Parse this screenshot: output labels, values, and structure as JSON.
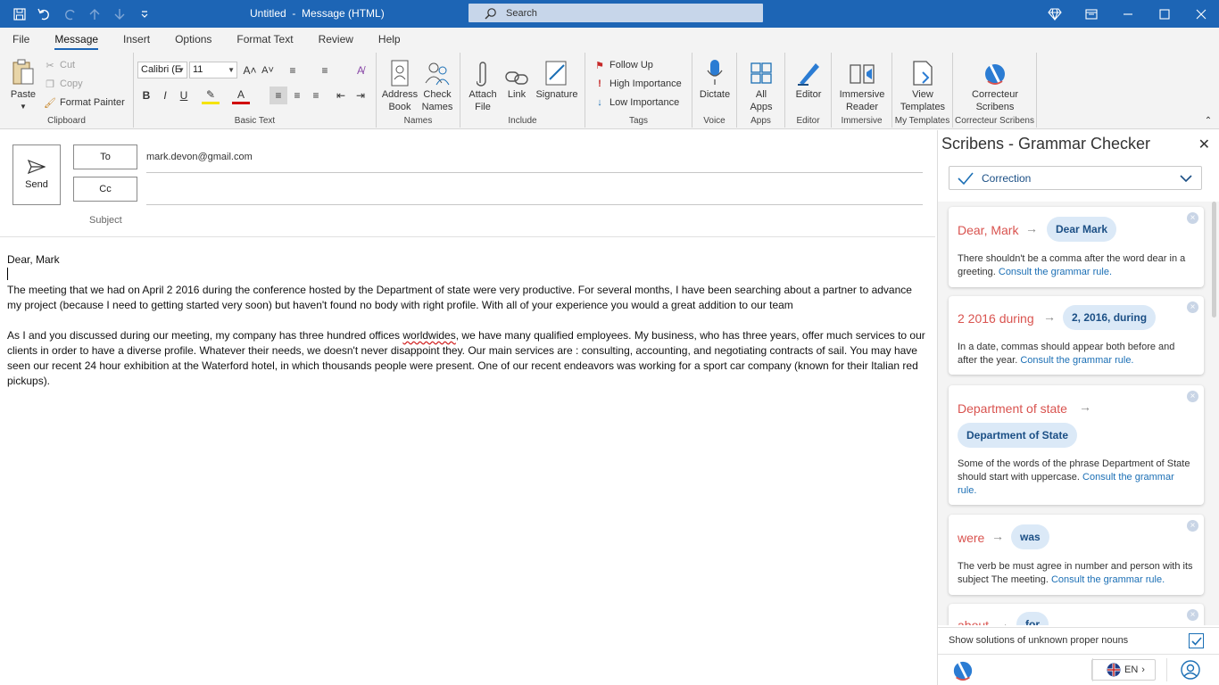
{
  "titlebar": {
    "title": "Untitled  -  Message (HTML)",
    "search_placeholder": "Search"
  },
  "tabs": [
    {
      "label": "File"
    },
    {
      "label": "Message"
    },
    {
      "label": "Insert"
    },
    {
      "label": "Options"
    },
    {
      "label": "Format Text"
    },
    {
      "label": "Review"
    },
    {
      "label": "Help"
    }
  ],
  "ribbon": {
    "clipboard": {
      "paste": "Paste",
      "cut": "Cut",
      "copy": "Copy",
      "format_painter": "Format Painter",
      "label": "Clipboard"
    },
    "basic_text": {
      "font": "Calibri (E",
      "size": "11",
      "label": "Basic Text"
    },
    "names": {
      "address_book_1": "Address",
      "address_book_2": "Book",
      "check_names_1": "Check",
      "check_names_2": "Names",
      "label": "Names"
    },
    "include": {
      "attach_1": "Attach",
      "attach_2": "File",
      "link": "Link",
      "signature": "Signature",
      "label": "Include"
    },
    "tags": {
      "follow_up": "Follow Up",
      "high": "High Importance",
      "low": "Low Importance",
      "label": "Tags"
    },
    "voice": {
      "dictate": "Dictate",
      "label": "Voice"
    },
    "apps": {
      "all_1": "All",
      "all_2": "Apps",
      "label": "Apps"
    },
    "editor": {
      "editor": "Editor",
      "label": "Editor"
    },
    "immersive": {
      "btn_1": "Immersive",
      "btn_2": "Reader",
      "label": "Immersive"
    },
    "templates": {
      "btn_1": "View",
      "btn_2": "Templates",
      "label": "My Templates"
    },
    "scribens": {
      "btn_1": "Correcteur",
      "btn_2": "Scribens",
      "label": "Correcteur Scribens"
    }
  },
  "compose": {
    "send": "Send",
    "to_label": "To",
    "to_value": "mark.devon@gmail.com",
    "cc_label": "Cc",
    "subject_label": "Subject"
  },
  "body": {
    "greeting": "Dear, Mark",
    "p1": "The meeting that we had on April 2 2016 during the conference hosted by the Department of state were very productive. For several months, I have been searching about a partner to advance my project (because I need to getting started very soon) but haven't found no body with right profile. With all of your experience you would a great addition to our team",
    "p2_before": "As I and you discussed during our meeting, my company has three hundred offices ",
    "p2_err": "worldwides",
    "p2_after": ", we have many qualified employees. My business, who has three years, offer much services to our clients in order to have a diverse profile. Whatever their needs, we doesn't never disappoint they. Our main services are : consulting, accounting, and negotiating contracts of sail. You may have seen our recent 24 hour exhibition at the Waterford hotel, in which thousands people were present. One of our recent endeavors was working for a sport car company (known for their Italian red pickups)."
  },
  "pane": {
    "title": "Scribens - Grammar Checker",
    "mode": "Correction",
    "cards": [
      {
        "orig": "Dear, Mark",
        "sugg": "Dear Mark",
        "expl": "There shouldn't be a comma after the word dear in a greeting. ",
        "rule": "Consult the grammar rule."
      },
      {
        "orig": "2 2016 during",
        "sugg": "2, 2016, during",
        "expl": "In a date, commas should appear both before and after the year. ",
        "rule": "Consult the grammar rule."
      },
      {
        "orig": "Department of state",
        "sugg": "Department of State",
        "expl": "Some of the words of the phrase Department of State should start with uppercase. ",
        "rule": "Consult the grammar rule."
      },
      {
        "orig": "were",
        "sugg": "was",
        "expl": "The verb be must agree in number and person with its subject The meeting. ",
        "rule": "Consult the grammar rule."
      },
      {
        "orig": "about",
        "sugg": "for"
      }
    ],
    "show_solutions": "Show solutions of unknown proper nouns",
    "lang": "EN"
  },
  "colors": {
    "accent": "#1d65b5",
    "error": "#d9534f",
    "suggestion_bg": "#dbe9f7"
  }
}
